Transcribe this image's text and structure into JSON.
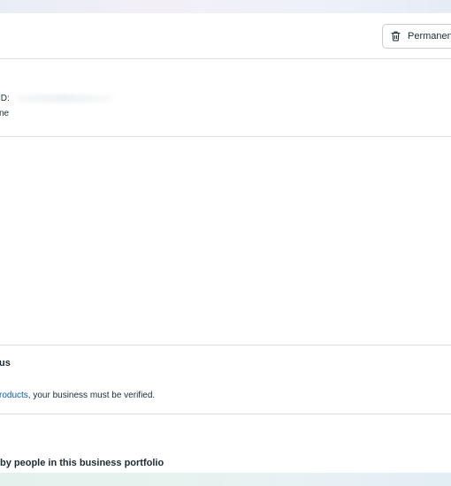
{
  "header": {
    "permanently_delete_label": "Permanen"
  },
  "info": {
    "id_label": "ID:",
    "name_fragment": "ne"
  },
  "status": {
    "title": "us",
    "text_link": "roducts",
    "text_rest": ", your business must be verified."
  },
  "access": {
    "title": " by people in this business portfolio"
  },
  "icons": {
    "trash": "trash-icon"
  }
}
